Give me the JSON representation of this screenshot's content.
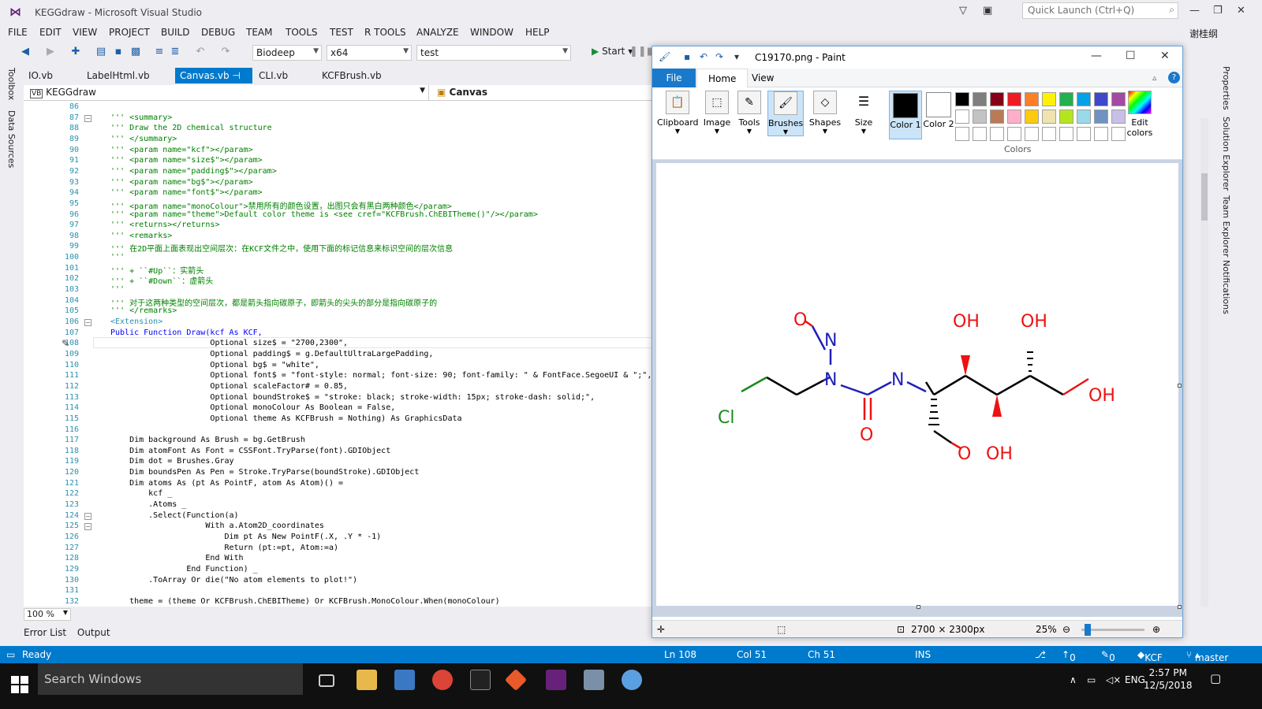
{
  "vs": {
    "window_title": "KEGGdraw - Microsoft Visual Studio",
    "quick_launch_placeholder": "Quick Launch (Ctrl+Q)",
    "user": "谢桂纲",
    "menu": [
      "FILE",
      "EDIT",
      "VIEW",
      "PROJECT",
      "BUILD",
      "DEBUG",
      "TEAM",
      "TOOLS",
      "TEST",
      "R TOOLS",
      "ANALYZE",
      "WINDOW",
      "HELP"
    ],
    "toolbar": {
      "project": "Biodeep",
      "platform": "x64",
      "target": "test",
      "start": "Start"
    },
    "tabs": [
      "IO.vb",
      "LabelHtml.vb",
      "Canvas.vb",
      "CLI.vb",
      "KCFBrush.vb"
    ],
    "active_tab": "Canvas.vb",
    "nav_left": "KEGGdraw",
    "nav_right": "Canvas",
    "left_sidebar": [
      "Toolbox",
      "Data Sources"
    ],
    "right_sidebar": [
      "Properties",
      "Solution Explorer",
      "Team Explorer",
      "Notifications"
    ],
    "zoom": "100 %",
    "bottom_tabs": [
      "Error List",
      "Output"
    ],
    "code_lines": [
      {
        "n": "86",
        "t": ""
      },
      {
        "n": "87",
        "t": "''' <summary>",
        "cls": "c"
      },
      {
        "n": "88",
        "t": "''' Draw the 2D chemical structure",
        "cls": "c"
      },
      {
        "n": "89",
        "t": "''' </summary>",
        "cls": "c"
      },
      {
        "n": "90",
        "t": "''' <param name=\"kcf\"></param>",
        "cls": "c"
      },
      {
        "n": "91",
        "t": "''' <param name=\"size$\"></param>",
        "cls": "c"
      },
      {
        "n": "92",
        "t": "''' <param name=\"padding$\"></param>",
        "cls": "c"
      },
      {
        "n": "93",
        "t": "''' <param name=\"bg$\"></param>",
        "cls": "c"
      },
      {
        "n": "94",
        "t": "''' <param name=\"font$\"></param>",
        "cls": "c"
      },
      {
        "n": "95",
        "t": "''' <param name=\"monoColour\">禁用所有的颜色设置，出图只会有黑白两种颜色</param>",
        "cls": "c"
      },
      {
        "n": "96",
        "t": "''' <param name=\"theme\">Default color theme is <see cref=\"KCFBrush.ChEBITheme()\"/></param>",
        "cls": "c"
      },
      {
        "n": "97",
        "t": "''' <returns></returns>",
        "cls": "c"
      },
      {
        "n": "98",
        "t": "''' <remarks>",
        "cls": "c"
      },
      {
        "n": "99",
        "t": "''' 在2D平面上面表现出空间层次：在KCF文件之中，使用下面的标记信息来标识空间的层次信息",
        "cls": "c"
      },
      {
        "n": "100",
        "t": "'''",
        "cls": "c"
      },
      {
        "n": "101",
        "t": "''' + ``#Up``：实箭头",
        "cls": "c"
      },
      {
        "n": "102",
        "t": "''' + ``#Down``：虚箭头",
        "cls": "c"
      },
      {
        "n": "103",
        "t": "'''",
        "cls": "c"
      },
      {
        "n": "104",
        "t": "''' 对于这两种类型的空间层次，都是箭头指向碳原子，即箭头的尖头的部分是指向碳原子的",
        "cls": "c"
      },
      {
        "n": "105",
        "t": "''' </remarks>",
        "cls": "c"
      },
      {
        "n": "106",
        "t": "<Extension>",
        "cls": "t"
      },
      {
        "n": "107",
        "t": "Public Function Draw(kcf As KCF,",
        "cls": "k"
      },
      {
        "n": "108",
        "t": "                     Optional size$ = \"2700,2300\",",
        "cls": ""
      },
      {
        "n": "109",
        "t": "                     Optional padding$ = g.DefaultUltraLargePadding,",
        "cls": ""
      },
      {
        "n": "110",
        "t": "                     Optional bg$ = \"white\",",
        "cls": ""
      },
      {
        "n": "111",
        "t": "                     Optional font$ = \"font-style: normal; font-size: 90; font-family: \" & FontFace.SegoeUI & \";\",",
        "cls": ""
      },
      {
        "n": "112",
        "t": "                     Optional scaleFactor# = 0.85,",
        "cls": ""
      },
      {
        "n": "113",
        "t": "                     Optional boundStroke$ = \"stroke: black; stroke-width: 15px; stroke-dash: solid;\",",
        "cls": ""
      },
      {
        "n": "114",
        "t": "                     Optional monoColour As Boolean = False,",
        "cls": ""
      },
      {
        "n": "115",
        "t": "                     Optional theme As KCFBrush = Nothing) As GraphicsData",
        "cls": ""
      },
      {
        "n": "116",
        "t": ""
      },
      {
        "n": "117",
        "t": "    Dim background As Brush = bg.GetBrush",
        "cls": ""
      },
      {
        "n": "118",
        "t": "    Dim atomFont As Font = CSSFont.TryParse(font).GDIObject",
        "cls": ""
      },
      {
        "n": "119",
        "t": "    Dim dot = Brushes.Gray",
        "cls": ""
      },
      {
        "n": "120",
        "t": "    Dim boundsPen As Pen = Stroke.TryParse(boundStroke).GDIObject",
        "cls": ""
      },
      {
        "n": "121",
        "t": "    Dim atoms As (pt As PointF, atom As Atom)() =",
        "cls": ""
      },
      {
        "n": "122",
        "t": "        kcf _",
        "cls": ""
      },
      {
        "n": "123",
        "t": "        .Atoms _",
        "cls": ""
      },
      {
        "n": "124",
        "t": "        .Select(Function(a)",
        "cls": ""
      },
      {
        "n": "125",
        "t": "                    With a.Atom2D_coordinates",
        "cls": ""
      },
      {
        "n": "126",
        "t": "                        Dim pt As New PointF(.X, .Y * -1)",
        "cls": ""
      },
      {
        "n": "127",
        "t": "                        Return (pt:=pt, Atom:=a)",
        "cls": ""
      },
      {
        "n": "128",
        "t": "                    End With",
        "cls": ""
      },
      {
        "n": "129",
        "t": "                End Function) _",
        "cls": ""
      },
      {
        "n": "130",
        "t": "        .ToArray Or die(\"No atom elements to plot!\")",
        "cls": ""
      },
      {
        "n": "131",
        "t": ""
      },
      {
        "n": "132",
        "t": "    theme = (theme Or KCFBrush.ChEBITheme) Or KCFBrush.MonoColour.When(monoColour)",
        "cls": ""
      }
    ],
    "status": {
      "ready": "Ready",
      "ln": "Ln 108",
      "col": "Col 51",
      "ch": "Ch 51",
      "ins": "INS",
      "pub": "0",
      "edits": "0",
      "repo": "KCF",
      "branch": "master"
    }
  },
  "paint": {
    "title": "C19170.png - Paint",
    "ribbon_tabs": [
      "File",
      "Home",
      "View"
    ],
    "groups": [
      "Clipboard",
      "Image",
      "Tools",
      "Brushes",
      "Shapes",
      "Size"
    ],
    "color1": "Color 1",
    "color2": "Color 2",
    "edit_colors": "Edit colors",
    "colors_label": "Colors",
    "palette": [
      "#000000",
      "#7f7f7f",
      "#880015",
      "#ed1c24",
      "#ff7f27",
      "#fff200",
      "#22b14c",
      "#00a2e8",
      "#3f48cc",
      "#a349a4",
      "#ffffff",
      "#c3c3c3",
      "#b97a57",
      "#ffaec9",
      "#ffc90e",
      "#efe4b0",
      "#b5e61d",
      "#99d9ea",
      "#7092be",
      "#c8bfe7"
    ],
    "dimensions": "2700 × 2300px",
    "zoom": "25%",
    "molecule_labels": {
      "cl": "Cl",
      "n": "N",
      "o": "O",
      "oh": "OH"
    }
  },
  "taskbar": {
    "search": "Search Windows",
    "lang": "ENG",
    "time": "2:57 PM",
    "date": "12/5/2018"
  },
  "colors": {
    "accent": "#007acc",
    "paint_file": "#1979ca",
    "n_blue": "#1f1fb8",
    "o_red": "#ee1111",
    "cl_green": "#1a8a1a"
  }
}
